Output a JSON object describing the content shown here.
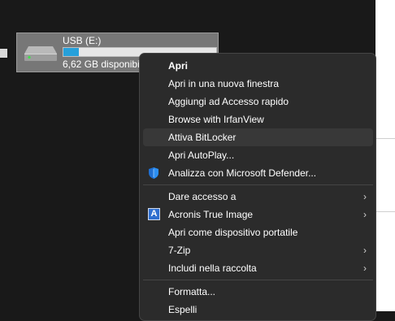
{
  "drive": {
    "name": "USB (E:)",
    "free": "6,62 GB disponibil",
    "usage_fraction": 0.1,
    "icon": "usb-drive-icon"
  },
  "menu": {
    "items": [
      {
        "label": "Apri",
        "bold": true
      },
      {
        "label": "Apri in una nuova finestra"
      },
      {
        "label": "Aggiungi ad Accesso rapido"
      },
      {
        "label": "Browse with IrfanView"
      },
      {
        "label": "Attiva BitLocker",
        "highlighted": true
      },
      {
        "label": "Apri AutoPlay..."
      },
      {
        "label": "Analizza con Microsoft Defender...",
        "icon": "defender-shield-icon"
      },
      {
        "label": "Dare accesso a",
        "submenu": true
      },
      {
        "label": "Acronis True Image",
        "icon": "acronis-icon",
        "icon_text": "A",
        "submenu": true
      },
      {
        "label": "Apri come dispositivo portatile"
      },
      {
        "label": "7-Zip",
        "submenu": true
      },
      {
        "label": "Includi nella raccolta",
        "submenu": true
      },
      {
        "label": "Formatta..."
      },
      {
        "label": "Espelli"
      }
    ],
    "chevron": "›"
  },
  "colors": {
    "menu_bg": "#2b2b2b",
    "highlight": "#383838",
    "accent": "#26a0da"
  }
}
